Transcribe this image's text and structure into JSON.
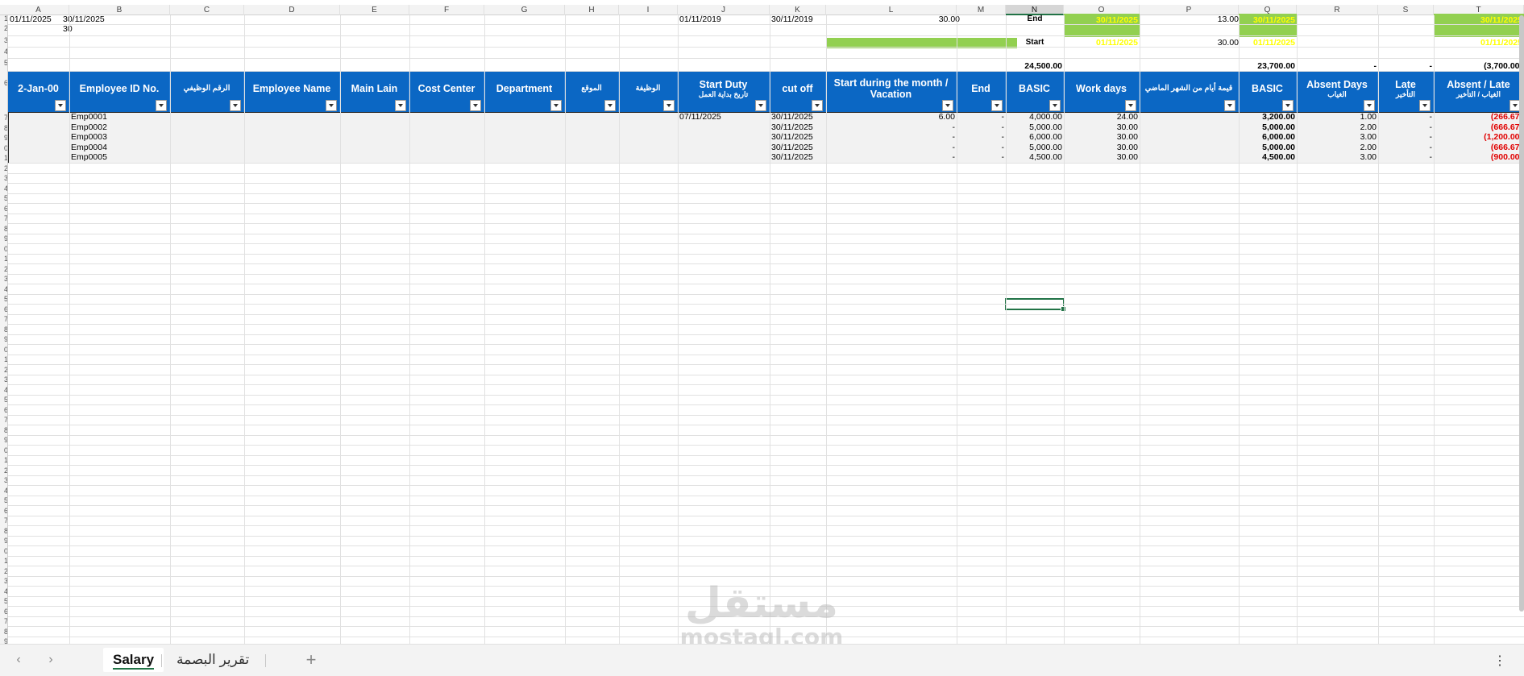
{
  "columns": [
    "A",
    "B",
    "C",
    "D",
    "E",
    "F",
    "G",
    "H",
    "I",
    "J",
    "K",
    "L",
    "M",
    "N",
    "O",
    "P",
    "Q",
    "R",
    "S",
    "T"
  ],
  "selected_column": "N",
  "row_numbers": [
    "1",
    "2",
    "3",
    "4",
    "5",
    "6",
    "7",
    "8",
    "9",
    "0",
    "1",
    "2",
    "3",
    "4",
    "5",
    "6",
    "7",
    "8",
    "9",
    "0",
    "1",
    "2",
    "3",
    "4",
    "5",
    "6",
    "7",
    "8",
    "9",
    "0",
    "1",
    "2",
    "3",
    "4",
    "5",
    "6",
    "7",
    "8",
    "9",
    "0",
    "1",
    "2",
    "3",
    "4",
    "5",
    "6",
    "7",
    "8",
    "9",
    "0",
    "1",
    "2",
    "3",
    "4",
    "5",
    "6",
    "7",
    "8",
    "9",
    "0",
    "1"
  ],
  "top": {
    "a1": "01/11/2025",
    "b1": "30/11/2025",
    "b2": "30",
    "j1": "01/11/2019",
    "k1": "30/11/2019",
    "l1": "30.00",
    "n1": "End",
    "o1": "30/11/2025",
    "p1": "13.00",
    "q1": "30/11/2025",
    "t1": "30/11/2025",
    "n3": "Start",
    "o3": "01/11/2025",
    "p3": "30.00",
    "q3": "01/11/2025",
    "t3": "01/11/2025",
    "n5": "24,500.00",
    "q5": "23,700.00",
    "r5": "-",
    "s5": "-",
    "t5": "(3,700.00)"
  },
  "headers": {
    "a": "2-Jan-00",
    "b": "Employee ID No.",
    "c": "الرقم الوظيفي",
    "d": "Employee Name",
    "e": "Main Lain",
    "f": "Cost Center",
    "g": "Department",
    "h": "الموقع",
    "i": "الوظيفة",
    "j": "Start Duty",
    "j_sub": "تاريخ بداية العمل",
    "k": "cut off",
    "l": "Start during the month /",
    "l2": "Vacation",
    "m": "End",
    "n": "BASIC",
    "o": "Work days",
    "p": "قيمة أيام من الشهر الماضي",
    "q": "BASIC",
    "r": "Absent Days",
    "r_sub": "الغياب",
    "s": "Late",
    "s_sub": "التأخير",
    "t": "Absent / Late",
    "t_sub": "الغياب / التأخير"
  },
  "rows": [
    {
      "id": "Emp0001",
      "start": "07/11/2025",
      "cutoff": "30/11/2025",
      "vac": "6.00",
      "end": "-",
      "basic": "4,000.00",
      "days": "24.00",
      "basic2": "3,200.00",
      "absent": "1.00",
      "late": "-",
      "abslate": "(266.67)"
    },
    {
      "id": "Emp0002",
      "start": "",
      "cutoff": "30/11/2025",
      "vac": "-",
      "end": "-",
      "basic": "5,000.00",
      "days": "30.00",
      "basic2": "5,000.00",
      "absent": "2.00",
      "late": "-",
      "abslate": "(666.67)"
    },
    {
      "id": "Emp0003",
      "start": "",
      "cutoff": "30/11/2025",
      "vac": "-",
      "end": "-",
      "basic": "6,000.00",
      "days": "30.00",
      "basic2": "6,000.00",
      "absent": "3.00",
      "late": "-",
      "abslate": "(1,200.00)"
    },
    {
      "id": "Emp0004",
      "start": "",
      "cutoff": "30/11/2025",
      "vac": "-",
      "end": "-",
      "basic": "5,000.00",
      "days": "30.00",
      "basic2": "5,000.00",
      "absent": "2.00",
      "late": "-",
      "abslate": "(666.67)"
    },
    {
      "id": "Emp0005",
      "start": "",
      "cutoff": "30/11/2025",
      "vac": "-",
      "end": "-",
      "basic": "4,500.00",
      "days": "30.00",
      "basic2": "4,500.00",
      "absent": "3.00",
      "late": "-",
      "abslate": "(900.00)"
    }
  ],
  "tabs": {
    "active": "Salary",
    "second": "تقرير البصمة",
    "add": "+"
  },
  "watermark": {
    "ar": "مستقل",
    "en": "mostaql.com"
  },
  "colors": {
    "header_blue": "#0b67c4",
    "green_fill": "#92d050",
    "yellow_text": "#ffff00",
    "negative_red": "#e00000",
    "selection": "#217346"
  }
}
